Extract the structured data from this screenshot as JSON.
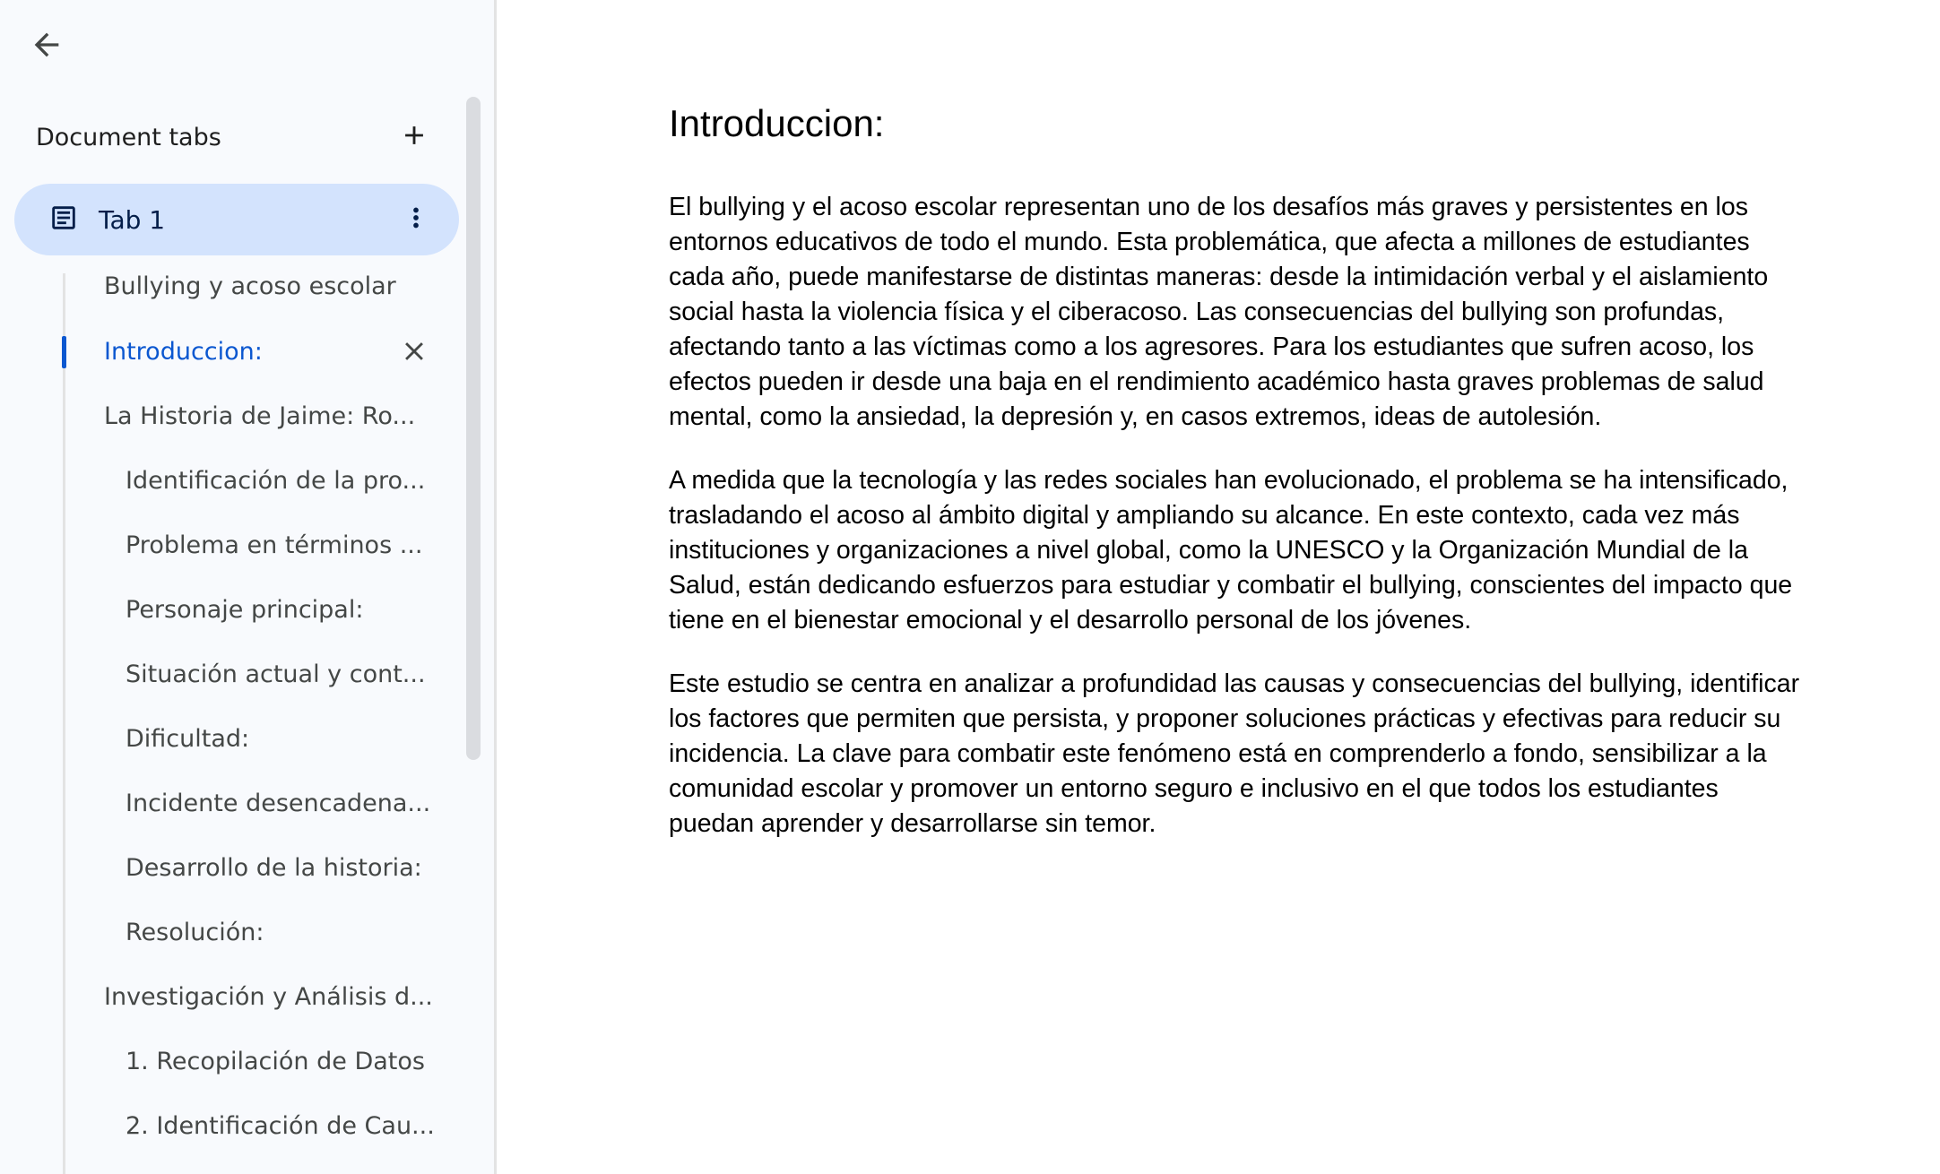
{
  "sidebar": {
    "back_icon": "arrow-back-icon",
    "title": "Document tabs",
    "add_icon": "plus-icon",
    "tab": {
      "label": "Tab 1",
      "icon": "document-icon",
      "more_icon": "more-vert-icon"
    },
    "outline": [
      {
        "label": "Bullying y acoso escolar",
        "level": 1,
        "active": false
      },
      {
        "label": "Introduccion:",
        "level": 1,
        "active": true
      },
      {
        "label": "La Historia de Jaime: Ro...",
        "level": 1,
        "active": false
      },
      {
        "label": "Identificación de la pro...",
        "level": 2,
        "active": false
      },
      {
        "label": "Problema en términos ...",
        "level": 2,
        "active": false
      },
      {
        "label": "Personaje principal:",
        "level": 2,
        "active": false
      },
      {
        "label": "Situación actual y cont...",
        "level": 2,
        "active": false
      },
      {
        "label": "Dificultad:",
        "level": 2,
        "active": false
      },
      {
        "label": "Incidente desencadena...",
        "level": 2,
        "active": false
      },
      {
        "label": "Desarrollo de la historia:",
        "level": 2,
        "active": false
      },
      {
        "label": "Resolución:",
        "level": 2,
        "active": false
      },
      {
        "label": "Investigación y Análisis d...",
        "level": 1,
        "active": false
      },
      {
        "label": "1. Recopilación de Datos",
        "level": 2,
        "active": false
      },
      {
        "label": "2. Identificación de Cau...",
        "level": 2,
        "active": false
      }
    ],
    "close_icon": "close-icon"
  },
  "document": {
    "heading": "Introduccion:",
    "paragraphs": [
      " El bullying y el acoso escolar representan uno de los desafíos más graves y persistentes en los entornos educativos de todo el mundo. Esta problemática, que afecta a millones de estudiantes cada año, puede manifestarse de distintas maneras: desde la intimidación verbal y el aislamiento social hasta la violencia física y el ciberacoso. Las consecuencias del bullying son profundas, afectando tanto a las víctimas como a los agresores. Para los estudiantes que sufren acoso, los efectos pueden ir desde una baja en el rendimiento académico hasta graves problemas de salud mental, como la ansiedad, la depresión y, en casos extremos, ideas de autolesión.",
      "A medida que la tecnología y las redes sociales han evolucionado, el problema se ha intensificado, trasladando el acoso al ámbito digital y ampliando su alcance. En este contexto, cada vez más instituciones y organizaciones a nivel global, como la UNESCO y la Organización Mundial de la Salud, están dedicando esfuerzos para estudiar y combatir el bullying, conscientes del impacto que tiene en el bienestar emocional y el desarrollo personal de los jóvenes.",
      "Este estudio se centra en analizar a profundidad las causas y consecuencias del bullying, identificar los factores que permiten que persista, y proponer soluciones prácticas y efectivas para reducir su incidencia. La clave para combatir este fenómeno está en comprenderlo a fondo, sensibilizar a la comunidad escolar y promover un entorno seguro e inclusivo en el que todos los estudiantes puedan aprender y desarrollarse sin temor."
    ]
  },
  "colors": {
    "sidebar_bg": "#f8fafd",
    "tab_selected_bg": "#d3e3fd",
    "accent": "#0b57d0",
    "text_secondary": "#444746"
  }
}
